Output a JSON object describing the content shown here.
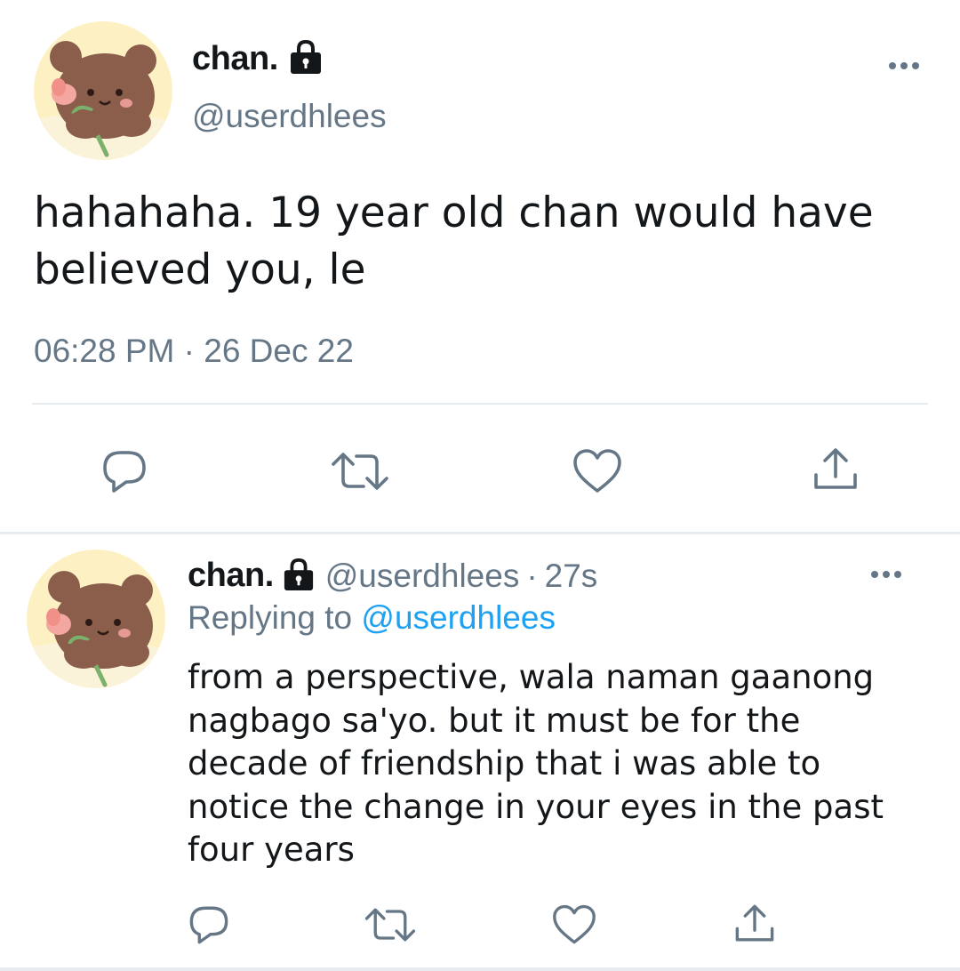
{
  "main_tweet": {
    "author_name": "chan.",
    "author_handle": "@userdhlees",
    "text": "hahahaha. 19 year old chan would have believed you, le",
    "timestamp": "06:28 PM · 26 Dec 22",
    "avatar_icon": "bear-holding-tulip-avatar",
    "protected_icon": "lock-icon"
  },
  "reply": {
    "author_name": "chan.",
    "author_handle": "@userdhlees",
    "separator": "·",
    "age": "27s",
    "replying_label": "Replying to",
    "replying_to": "@userdhlees",
    "text": "from a perspective, wala naman gaanong nagbago sa'yo. but it must be for the decade of friendship that i was able to notice the change in your eyes in the past four years",
    "avatar_icon": "bear-holding-tulip-avatar"
  },
  "actions": [
    "reply-icon",
    "retweet-icon",
    "like-icon",
    "share-icon"
  ],
  "colors": {
    "text": "#14171a",
    "secondary": "#657786",
    "link": "#1da1f2",
    "divider": "#e6ecf0",
    "avatar_bg": "#fdf1c4",
    "bear": "#8b5e4c"
  }
}
